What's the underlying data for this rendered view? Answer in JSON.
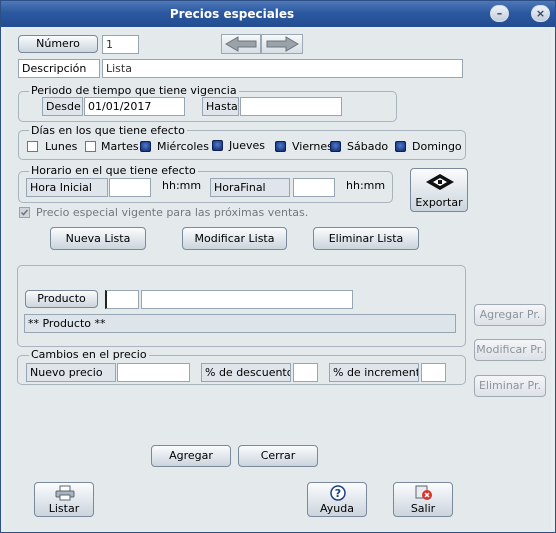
{
  "window": {
    "title": "Precios especiales"
  },
  "header": {
    "numero_label": "Número",
    "numero_value": "1",
    "descripcion_label": "Descripción",
    "descripcion_value": "Lista"
  },
  "periodo": {
    "title": "Periodo de tiempo que tiene vigencia",
    "desde_label": "Desde",
    "desde_value": "01/01/2017",
    "hasta_label": "Hasta",
    "hasta_value": ""
  },
  "dias": {
    "title": "Días en los que tiene efecto",
    "items": [
      {
        "label": "Lunes",
        "checked": false
      },
      {
        "label": "Martes",
        "checked": false
      },
      {
        "label": "Miércoles",
        "checked": true
      },
      {
        "label": "Jueves",
        "checked": true
      },
      {
        "label": "Viernes",
        "checked": true
      },
      {
        "label": "Sábado",
        "checked": true
      },
      {
        "label": "Domingo",
        "checked": true
      }
    ]
  },
  "horario": {
    "title": "Horario en el que tiene efecto",
    "hora_inicial_label": "Hora Inicial",
    "hora_inicial_value": "",
    "hhmm1": "hh:mm",
    "hora_final_label": "HoraFinal",
    "hora_final_value": "",
    "hhmm2": "hh:mm"
  },
  "exportar_label": "Exportar",
  "vigente_label": "Precio especial vigente para las próximas ventas.",
  "lista_buttons": {
    "nueva": "Nueva Lista",
    "modificar": "Modificar Lista",
    "eliminar": "Eliminar Lista"
  },
  "producto": {
    "button": "Producto",
    "code": "",
    "name": "",
    "info": "** Producto **"
  },
  "cambios": {
    "title": "Cambios en el precio",
    "nuevo_precio_label": "Nuevo precio",
    "nuevo_precio_value": "",
    "descuento_label": "% de descuento",
    "descuento_value": "",
    "incremento_label": "% de incremento",
    "incremento_value": ""
  },
  "side_buttons": {
    "agregar_pr": "Agregar Pr.",
    "modificar_pr": "Modificar Pr.",
    "eliminar_pr": "Eliminar Pr."
  },
  "bottom_buttons": {
    "agregar": "Agregar",
    "cerrar": "Cerrar",
    "listar": "Listar",
    "ayuda": "Ayuda",
    "salir": "Salir"
  },
  "icons": {
    "minimize": "minimize-icon",
    "close": "close-icon",
    "prev": "arrow-left-icon",
    "next": "arrow-right-icon",
    "exportar": "diskette-icon",
    "listar": "printer-icon",
    "ayuda": "help-icon",
    "salir": "exit-icon"
  }
}
